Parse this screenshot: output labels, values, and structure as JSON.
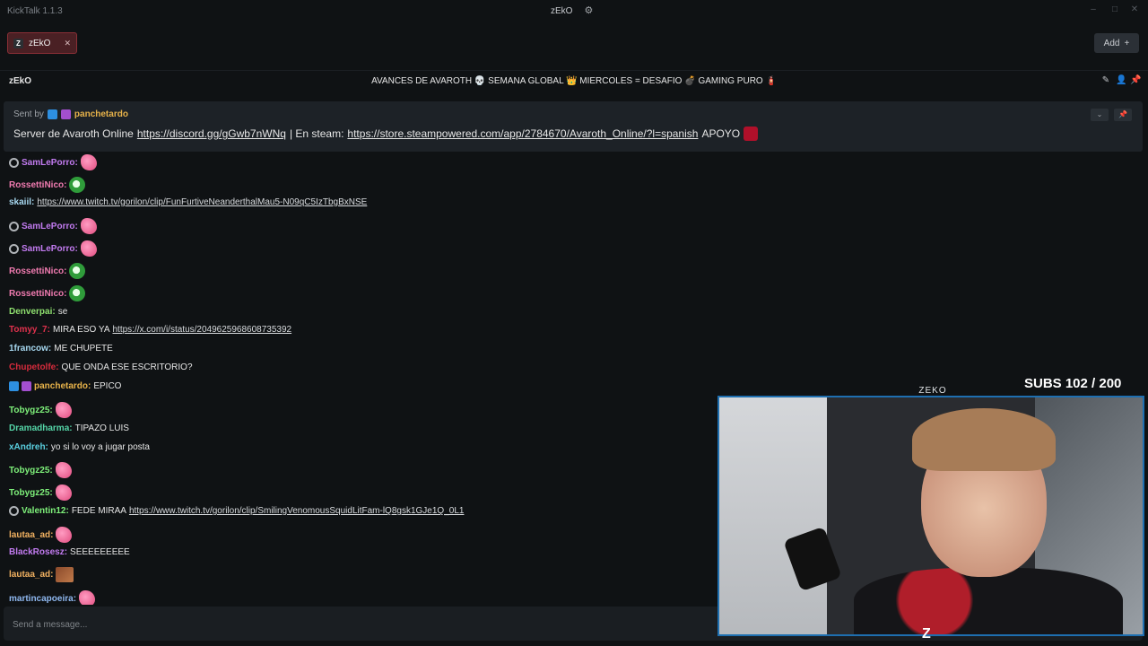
{
  "app": {
    "title": "KickTalk 1.1.3",
    "window_label": "zEkO"
  },
  "tabs": [
    {
      "label": "zEkO",
      "avatar_letter": "Z"
    }
  ],
  "add_button": {
    "label": "Add"
  },
  "channel": {
    "name": "zEkO",
    "title": "AVANCES DE AVAROTH 💀 SEMANA GLOBAL 👑 MIERCOLES = DESAFIO 💣 GAMING PURO 🧯"
  },
  "pinned": {
    "sent_by": "Sent by",
    "sender": "panchetardo",
    "text_prefix": "Server de Avaroth Online",
    "link1": "https://discord.gg/gGwb7nWNq",
    "separator": "| En steam:",
    "link2": "https://store.steampowered.com/app/2784670/Avaroth_Online/?l=spanish",
    "suffix": "APOYO"
  },
  "messages": [
    {
      "user": "SamLePorro:",
      "color": "#c27bf0",
      "badge": "round",
      "emote": "pink"
    },
    {
      "user": "RossettiNico:",
      "color": "#f07bb0",
      "emote": "green"
    },
    {
      "user": "skaiil:",
      "color": "#a7d8f0",
      "link": "https://www.twitch.tv/gorilon/clip/FunFurtiveNeanderthalMau5-N09qC5IzTbgBxNSE"
    },
    {
      "user": "SamLePorro:",
      "color": "#c27bf0",
      "badge": "round",
      "emote": "pink"
    },
    {
      "user": "SamLePorro:",
      "color": "#c27bf0",
      "badge": "round",
      "emote": "pink"
    },
    {
      "user": "RossettiNico:",
      "color": "#f07bb0",
      "emote": "green"
    },
    {
      "user": "RossettiNico:",
      "color": "#f07bb0",
      "emote": "green"
    },
    {
      "user": "Denverpai:",
      "color": "#8fe06f",
      "text": "se"
    },
    {
      "user": "Tomyy_7:",
      "color": "#e0314d",
      "text": "MIRA ESO YA",
      "link": "https://x.com/i/status/2049625968608735392"
    },
    {
      "user": "1francow:",
      "color": "#a7d8f0",
      "text": "ME CHUPETE"
    },
    {
      "user": "Chupetolfe:",
      "color": "#d62b3c",
      "text": "QUE ONDA ESE ESCRITORIO?"
    },
    {
      "user": "panchetardo:",
      "color": "#e8b34a",
      "badge": "blue-purple",
      "text": "EPICO"
    },
    {
      "user": "Tobygz25:",
      "color": "#7ef07a",
      "emote": "pink"
    },
    {
      "user": "Dramadharma:",
      "color": "#55d6a8",
      "text": "TIPAZO LUIS"
    },
    {
      "user": "xAndreh:",
      "color": "#5ad0e0",
      "text": "yo si lo voy a jugar posta"
    },
    {
      "user": "Tobygz25:",
      "color": "#7ef07a",
      "emote": "pink"
    },
    {
      "user": "Tobygz25:",
      "color": "#7ef07a",
      "emote": "pink"
    },
    {
      "user": "Valentin12:",
      "color": "#7ef07a",
      "badge": "round",
      "text": "FEDE MIRAA",
      "link": "https://www.twitch.tv/gorilon/clip/SmilingVenomousSquidLitFam-lQ8gsk1GJe1Q_0L1"
    },
    {
      "user": "lautaa_ad:",
      "color": "#f0b060",
      "emote": "pink"
    },
    {
      "user": "BlackRosesz:",
      "color": "#c27bf0",
      "text": "SEEEEEEEEE"
    },
    {
      "user": "lautaa_ad:",
      "color": "#f0b060",
      "emote": "brown"
    },
    {
      "user": "martincapoeira:",
      "color": "#8fb8f0",
      "emote": "pink"
    }
  ],
  "input": {
    "placeholder": "Send a message..."
  },
  "overlay": {
    "subs": "SUBS 102 / 200",
    "cam_label": "ZEKO"
  }
}
